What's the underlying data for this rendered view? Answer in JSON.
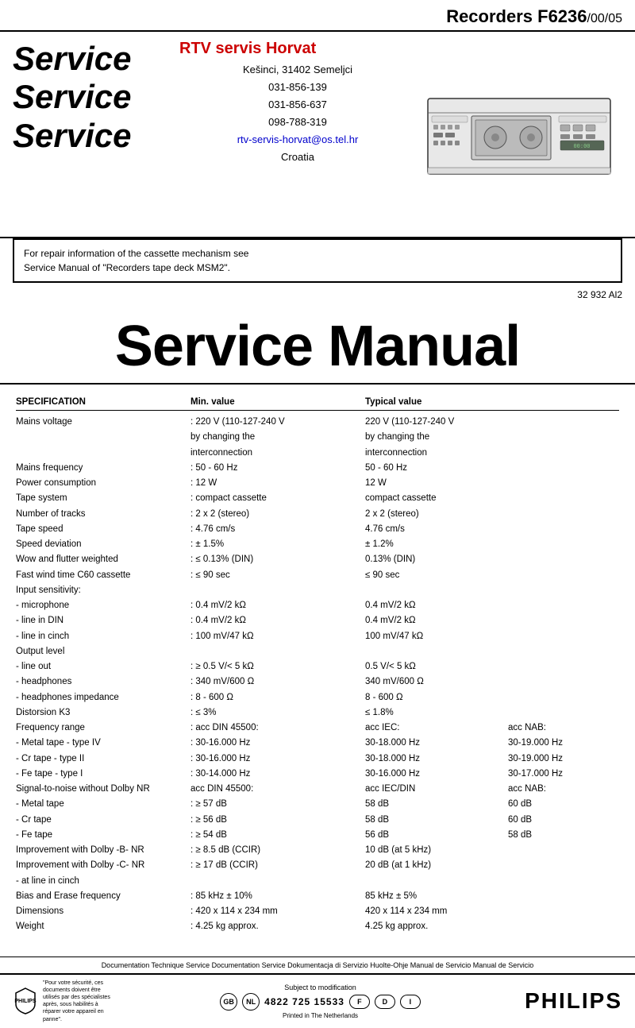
{
  "header": {
    "recorder_label": "Recorders F6236",
    "variant": "/00/05"
  },
  "service_words": [
    "Service",
    "Service",
    "Service"
  ],
  "company": {
    "name": "RTV servis Horvat",
    "address1": "Kešinci, 31402 Semeljci",
    "phone1": "031-856-139",
    "phone2": "031-856-637",
    "phone3": "098-788-319",
    "email": "rtv-servis-horvat@os.tel.hr",
    "country": "Croatia"
  },
  "repair_info": "For repair information of the cassette mechanism see\nService Manual  of \"Recorders tape deck MSM2\".",
  "part_number": "32 932 Al2",
  "main_title": "Service Manual",
  "spec": {
    "title": "SPECIFICATION",
    "col_min": "Min. value",
    "col_typ": "Typical value",
    "rows": [
      {
        "label": "Mains voltage",
        "min": ": 220 V (110-127-240 V",
        "typ": "220 V (110-127-240 V",
        "nab": ""
      },
      {
        "label": "",
        "min": "  by changing the",
        "typ": "by changing the",
        "nab": ""
      },
      {
        "label": "",
        "min": "  interconnection",
        "typ": "interconnection",
        "nab": ""
      },
      {
        "label": "Mains frequency",
        "min": ": 50 - 60 Hz",
        "typ": "50 - 60 Hz",
        "nab": ""
      },
      {
        "label": "Power consumption",
        "min": ": 12 W",
        "typ": "12 W",
        "nab": ""
      },
      {
        "label": "Tape system",
        "min": ": compact cassette",
        "typ": "compact cassette",
        "nab": ""
      },
      {
        "label": "Number of tracks",
        "min": ": 2 x 2 (stereo)",
        "typ": "2 x 2 (stereo)",
        "nab": ""
      },
      {
        "label": "Tape speed",
        "min": ": 4.76 cm/s",
        "typ": "4.76 cm/s",
        "nab": ""
      },
      {
        "label": "Speed deviation",
        "min": ": ± 1.5%",
        "typ": "± 1.2%",
        "nab": ""
      },
      {
        "label": "Wow and flutter weighted",
        "min": ": ≤ 0.13% (DIN)",
        "typ": "0.13% (DIN)",
        "nab": ""
      },
      {
        "label": "Fast wind time C60 cassette",
        "min": ": ≤ 90 sec",
        "typ": "≤ 90 sec",
        "nab": ""
      },
      {
        "label": "Input sensitivity:",
        "min": "",
        "typ": "",
        "nab": ""
      },
      {
        "label": "  - microphone",
        "min": ": 0.4 mV/2 kΩ",
        "typ": "0.4 mV/2 kΩ",
        "nab": ""
      },
      {
        "label": "  - line in DIN",
        "min": ": 0.4 mV/2 kΩ",
        "typ": "0.4 mV/2 kΩ",
        "nab": ""
      },
      {
        "label": "  - line in cinch",
        "min": ": 100 mV/47 kΩ",
        "typ": "100 mV/47 kΩ",
        "nab": ""
      },
      {
        "label": "Output level",
        "min": "",
        "typ": "",
        "nab": ""
      },
      {
        "label": "  - line out",
        "min": ": ≥ 0.5 V/< 5 kΩ",
        "typ": "0.5 V/< 5 kΩ",
        "nab": ""
      },
      {
        "label": "  - headphones",
        "min": ": 340 mV/600 Ω",
        "typ": "340 mV/600 Ω",
        "nab": ""
      },
      {
        "label": "  - headphones impedance",
        "min": ": 8 - 600 Ω",
        "typ": "8 - 600 Ω",
        "nab": ""
      },
      {
        "label": "Distorsion K3",
        "min": ": ≤ 3%",
        "typ": "≤ 1.8%",
        "nab": ""
      },
      {
        "label": "Frequency range",
        "min": ": acc DIN 45500:",
        "typ": "acc IEC:",
        "nab": "acc NAB:"
      },
      {
        "label": "  - Metal tape - type IV",
        "min": ": 30-16.000 Hz",
        "typ": "30-18.000 Hz",
        "nab": "30-19.000 Hz"
      },
      {
        "label": "  - Cr tape - type II",
        "min": ": 30-16.000 Hz",
        "typ": "30-18.000 Hz",
        "nab": "30-19.000 Hz"
      },
      {
        "label": "  - Fe tape - type I",
        "min": ": 30-14.000 Hz",
        "typ": "30-16.000 Hz",
        "nab": "30-17.000 Hz"
      },
      {
        "label": "Signal-to-noise without Dolby NR",
        "min": "acc DIN 45500:",
        "typ": "acc IEC/DIN",
        "nab": "acc NAB:"
      },
      {
        "label": "  - Metal tape",
        "min": ": ≥ 57 dB",
        "typ": "58 dB",
        "nab": "60 dB"
      },
      {
        "label": "  - Cr tape",
        "min": ": ≥ 56 dB",
        "typ": "58 dB",
        "nab": "60 dB"
      },
      {
        "label": "  - Fe tape",
        "min": ": ≥ 54 dB",
        "typ": "56 dB",
        "nab": "58 dB"
      },
      {
        "label": "Improvement with Dolby -B- NR",
        "min": ": ≥ 8.5 dB (CCIR)",
        "typ": "10 dB (at 5 kHz)",
        "nab": ""
      },
      {
        "label": "Improvement with Dolby -C- NR",
        "min": ": ≥ 17 dB (CCIR)",
        "typ": "20 dB (at 1 kHz)",
        "nab": ""
      },
      {
        "label": "  - at line in cinch",
        "min": "",
        "typ": "",
        "nab": ""
      },
      {
        "label": "Bias and Erase frequency",
        "min": ": 85 kHz ± 10%",
        "typ": "85 kHz ± 5%",
        "nab": ""
      },
      {
        "label": "Dimensions",
        "min": ": 420 x 114 x 234 mm",
        "typ": "420 x 114 x 234 mm",
        "nab": ""
      },
      {
        "label": "Weight",
        "min": ": 4.25 kg approx.",
        "typ": "4.25 kg approx.",
        "nab": ""
      }
    ]
  },
  "doc_footer": "Documentation Technique Service Documentation Service Dokumentacja di Servizio Huolte-Ohje Manual de Servicio Manual de Servicio",
  "bottom_bar": {
    "safety_text": "\"Pour votre sécurité, ces documents doivent être utilisés par des spécialistes après, sous habilités à réparer votre appareil en panne\".",
    "subject": "Subject to modification",
    "badges": [
      "GB",
      "NL"
    ],
    "phone": "4822 725 15533",
    "fd_badges": [
      "F",
      "D",
      "I"
    ],
    "printed": "Printed in The Netherlands",
    "philips": "PHILIPS"
  }
}
